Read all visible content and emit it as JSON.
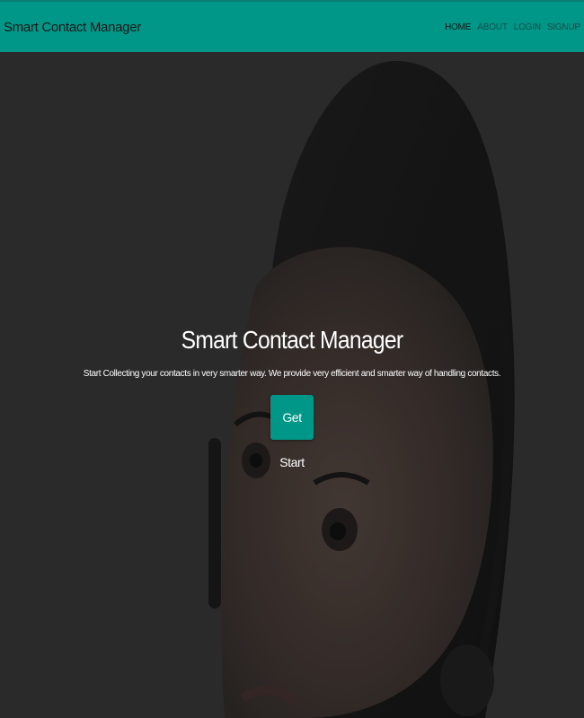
{
  "navbar": {
    "brand": "Smart Contact Manager",
    "links": [
      {
        "label": "HOME"
      },
      {
        "label": "ABOUT"
      },
      {
        "label": "LOGIN"
      },
      {
        "label": "SIGNUP"
      }
    ]
  },
  "hero": {
    "title": "Smart Contact Manager",
    "subtitle": "Start Collecting your contacts in very smarter way. We provide very efficient and smarter way of handling contacts.",
    "cta_label": "Get Start"
  },
  "colors": {
    "primary": "#009688",
    "background": "#2e2e2e",
    "text": "#ffffff"
  }
}
